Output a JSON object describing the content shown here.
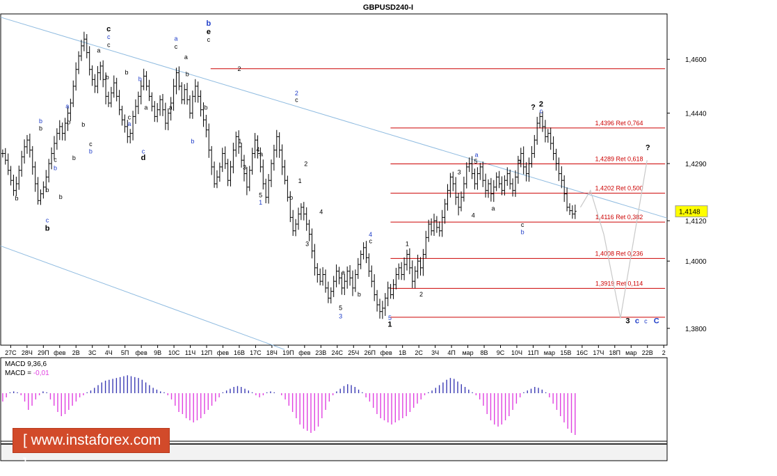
{
  "colors": {
    "background": "#ffffff",
    "frame": "#000000",
    "price": "#000000",
    "channel": "#8fbbe0",
    "retracement": "#cc0000",
    "current_price_bg": "#ffff00",
    "projection": "#c8c8c8",
    "macd_positive": "#3a3ab4",
    "macd_negative": "#e040e0",
    "macd_signal": "#e040e0",
    "watermark_bg": "#d24a2a",
    "label_black": "#000000",
    "label_blue": "#1e3cc8"
  },
  "chart_data": {
    "type": "candlestick",
    "title": "GBPUSD240-I",
    "symbol": "GBPUSD",
    "timeframe": "H4",
    "ylim": [
      1.375,
      1.4735
    ],
    "y_ticks": [
      "1,4600",
      "1,4440",
      "1,4290",
      "1,4120",
      "1,4000",
      "1,3800"
    ],
    "current_price": "1,4148",
    "x_tick_labels": [
      "27С",
      "28Ч",
      "29П",
      "фев",
      "2В",
      "3С",
      "4Ч",
      "5П",
      "фев",
      "9В",
      "10С",
      "11Ч",
      "12П",
      "фев",
      "16В",
      "17С",
      "18Ч",
      "19П",
      "фев",
      "23В",
      "24С",
      "25Ч",
      "26П",
      "фев",
      "1В",
      "2С",
      "3Ч",
      "4П",
      "мар",
      "8В",
      "9С",
      "10Ч",
      "11П",
      "мар",
      "15В",
      "16С",
      "17Ч",
      "18П",
      "мар",
      "22В",
      "2"
    ],
    "close_path": [
      1.432,
      1.43,
      1.427,
      1.424,
      1.421,
      1.423,
      1.427,
      1.431,
      1.434,
      1.436,
      1.433,
      1.428,
      1.423,
      1.418,
      1.42,
      1.422,
      1.425,
      1.429,
      1.432,
      1.435,
      1.438,
      1.44,
      1.438,
      1.441,
      1.444,
      1.447,
      1.452,
      1.457,
      1.461,
      1.464,
      1.466,
      1.462,
      1.457,
      1.454,
      1.452,
      1.456,
      1.458,
      1.454,
      1.449,
      1.447,
      1.45,
      1.453,
      1.449,
      1.445,
      1.442,
      1.44,
      1.437,
      1.438,
      1.443,
      1.446,
      1.449,
      1.452,
      1.455,
      1.452,
      1.449,
      1.446,
      1.443,
      1.445,
      1.448,
      1.445,
      1.441,
      1.444,
      1.447,
      1.452,
      1.456,
      1.452,
      1.448,
      1.451,
      1.448,
      1.444,
      1.449,
      1.452,
      1.449,
      1.445,
      1.442,
      1.439,
      1.433,
      1.428,
      1.423,
      1.425,
      1.428,
      1.432,
      1.429,
      1.424,
      1.428,
      1.433,
      1.437,
      1.434,
      1.43,
      1.426,
      1.422,
      1.427,
      1.432,
      1.436,
      1.432,
      1.428,
      1.423,
      1.419,
      1.424,
      1.429,
      1.433,
      1.437,
      1.433,
      1.428,
      1.424,
      1.419,
      1.413,
      1.409,
      1.411,
      1.414,
      1.416,
      1.414,
      1.411,
      1.408,
      1.403,
      1.398,
      1.396,
      1.394,
      1.396,
      1.392,
      1.389,
      1.391,
      1.394,
      1.397,
      1.395,
      1.392,
      1.394,
      1.397,
      1.395,
      1.392,
      1.396,
      1.399,
      1.402,
      1.404,
      1.401,
      1.397,
      1.394,
      1.39,
      1.387,
      1.385,
      1.386,
      1.389,
      1.392,
      1.39,
      1.393,
      1.396,
      1.398,
      1.396,
      1.399,
      1.402,
      1.398,
      1.394,
      1.397,
      1.4,
      1.398,
      1.402,
      1.407,
      1.411,
      1.409,
      1.412,
      1.41,
      1.409,
      1.413,
      1.417,
      1.421,
      1.425,
      1.423,
      1.419,
      1.416,
      1.419,
      1.423,
      1.428,
      1.429,
      1.426,
      1.423,
      1.426,
      1.428,
      1.424,
      1.421,
      1.423,
      1.42,
      1.422,
      1.425,
      1.423,
      1.421,
      1.424,
      1.426,
      1.423,
      1.421,
      1.425,
      1.43,
      1.432,
      1.428,
      1.426,
      1.429,
      1.432,
      1.436,
      1.441,
      1.443,
      1.44,
      1.437,
      1.438,
      1.435,
      1.432,
      1.429,
      1.426,
      1.424,
      1.42,
      1.416,
      1.415,
      1.414,
      1.4148
    ],
    "channel_lines": [
      {
        "x": [
          0,
          1
        ],
        "y": [
          1.4725,
          1.4128
        ]
      },
      {
        "x": [
          0,
          0.426
        ],
        "y": [
          1.4045,
          1.3737
        ]
      }
    ],
    "fibonacci": [
      {
        "price": 1.4572,
        "label": ""
      },
      {
        "price": 1.4396,
        "label": "1,4396 Ret 0,764"
      },
      {
        "price": 1.4289,
        "label": "1,4289 Ret 0,618"
      },
      {
        "price": 1.4202,
        "label": "1,4202 Ret 0,500"
      },
      {
        "price": 1.4116,
        "label": "1,4116 Ret 0,382"
      },
      {
        "price": 1.4008,
        "label": "1,4008 Ret 0,236"
      },
      {
        "price": 1.3919,
        "label": "1,3919 Ret 0,114"
      },
      {
        "price": 1.3833,
        "label": ""
      }
    ],
    "projection": {
      "x": [
        0.87,
        0.885,
        0.905,
        0.93,
        0.97
      ],
      "y": [
        1.416,
        1.421,
        1.408,
        1.383,
        1.43
      ]
    },
    "wave_labels": [
      {
        "text": "c",
        "x": 0.162,
        "y": 1.4683,
        "color": "black",
        "bold": true
      },
      {
        "text": "c",
        "x": 0.162,
        "y": 1.466,
        "color": "blue"
      },
      {
        "text": "c",
        "x": 0.162,
        "y": 1.4637,
        "color": "black"
      },
      {
        "text": "a",
        "x": 0.147,
        "y": 1.462,
        "color": "black"
      },
      {
        "text": "b",
        "x": 0.06,
        "y": 1.441,
        "color": "blue"
      },
      {
        "text": "b",
        "x": 0.06,
        "y": 1.4388,
        "color": "black"
      },
      {
        "text": "b",
        "x": 0.024,
        "y": 1.418,
        "color": "black"
      },
      {
        "text": "a",
        "x": 0.1,
        "y": 1.4455,
        "color": "blue"
      },
      {
        "text": "b",
        "x": 0.102,
        "y": 1.4407,
        "color": "black"
      },
      {
        "text": "c",
        "x": 0.082,
        "y": 1.4295,
        "color": "black"
      },
      {
        "text": "b",
        "x": 0.082,
        "y": 1.427,
        "color": "blue"
      },
      {
        "text": "b",
        "x": 0.07,
        "y": 1.4205,
        "color": "black"
      },
      {
        "text": "b",
        "x": 0.09,
        "y": 1.4185,
        "color": "black"
      },
      {
        "text": "b",
        "x": 0.11,
        "y": 1.43,
        "color": "black"
      },
      {
        "text": "c",
        "x": 0.07,
        "y": 1.4115,
        "color": "blue"
      },
      {
        "text": "b",
        "x": 0.07,
        "y": 1.409,
        "color": "black",
        "bold": true
      },
      {
        "text": "b",
        "x": 0.124,
        "y": 1.44,
        "color": "black"
      },
      {
        "text": "c",
        "x": 0.135,
        "y": 1.4342,
        "color": "black"
      },
      {
        "text": "b",
        "x": 0.135,
        "y": 1.432,
        "color": "blue"
      },
      {
        "text": "b",
        "x": 0.16,
        "y": 1.454,
        "color": "black"
      },
      {
        "text": "b",
        "x": 0.189,
        "y": 1.4555,
        "color": "black"
      },
      {
        "text": "b",
        "x": 0.209,
        "y": 1.4535,
        "color": "blue"
      },
      {
        "text": "c",
        "x": 0.193,
        "y": 1.4422,
        "color": "black"
      },
      {
        "text": "a",
        "x": 0.193,
        "y": 1.4402,
        "color": "blue"
      },
      {
        "text": "a",
        "x": 0.218,
        "y": 1.445,
        "color": "black"
      },
      {
        "text": "c",
        "x": 0.214,
        "y": 1.432,
        "color": "blue"
      },
      {
        "text": "d",
        "x": 0.214,
        "y": 1.43,
        "color": "black",
        "bold": true
      },
      {
        "text": "a",
        "x": 0.263,
        "y": 1.4655,
        "color": "blue"
      },
      {
        "text": "c",
        "x": 0.263,
        "y": 1.4632,
        "color": "black"
      },
      {
        "text": "b",
        "x": 0.312,
        "y": 1.47,
        "color": "blue",
        "bold": true
      },
      {
        "text": "e",
        "x": 0.312,
        "y": 1.4675,
        "color": "black",
        "bold": true
      },
      {
        "text": "c",
        "x": 0.312,
        "y": 1.4652,
        "color": "black"
      },
      {
        "text": "a",
        "x": 0.278,
        "y": 1.46,
        "color": "black"
      },
      {
        "text": "b",
        "x": 0.28,
        "y": 1.455,
        "color": "black"
      },
      {
        "text": "a",
        "x": 0.255,
        "y": 1.445,
        "color": "black"
      },
      {
        "text": "b",
        "x": 0.288,
        "y": 1.435,
        "color": "blue"
      },
      {
        "text": "b",
        "x": 0.308,
        "y": 1.445,
        "color": "black"
      },
      {
        "text": "2",
        "x": 0.358,
        "y": 1.4565,
        "color": "black"
      },
      {
        "text": "1",
        "x": 0.359,
        "y": 1.435,
        "color": "black"
      },
      {
        "text": "3",
        "x": 0.366,
        "y": 1.4272,
        "color": "black"
      },
      {
        "text": "4",
        "x": 0.386,
        "y": 1.4325,
        "color": "black"
      },
      {
        "text": "a",
        "x": 0.391,
        "y": 1.4312,
        "color": "black"
      },
      {
        "text": "5",
        "x": 0.39,
        "y": 1.419,
        "color": "black"
      },
      {
        "text": "1",
        "x": 0.39,
        "y": 1.4168,
        "color": "blue"
      },
      {
        "text": "2",
        "x": 0.444,
        "y": 1.4493,
        "color": "blue"
      },
      {
        "text": "c",
        "x": 0.444,
        "y": 1.4473,
        "color": "black"
      },
      {
        "text": "b",
        "x": 0.436,
        "y": 1.4183,
        "color": "black"
      },
      {
        "text": "1",
        "x": 0.449,
        "y": 1.4232,
        "color": "black"
      },
      {
        "text": "2",
        "x": 0.458,
        "y": 1.4283,
        "color": "black"
      },
      {
        "text": "4",
        "x": 0.481,
        "y": 1.414,
        "color": "black"
      },
      {
        "text": "3",
        "x": 0.46,
        "y": 1.4045,
        "color": "black"
      },
      {
        "text": "a",
        "x": 0.514,
        "y": 1.396,
        "color": "black"
      },
      {
        "text": "b",
        "x": 0.538,
        "y": 1.3895,
        "color": "black"
      },
      {
        "text": "5",
        "x": 0.51,
        "y": 1.3855,
        "color": "black"
      },
      {
        "text": "3",
        "x": 0.51,
        "y": 1.383,
        "color": "blue"
      },
      {
        "text": "4",
        "x": 0.555,
        "y": 1.4073,
        "color": "blue"
      },
      {
        "text": "c",
        "x": 0.555,
        "y": 1.4053,
        "color": "black"
      },
      {
        "text": "5",
        "x": 0.584,
        "y": 1.3825,
        "color": "blue"
      },
      {
        "text": "1",
        "x": 0.584,
        "y": 1.3805,
        "color": "black",
        "bold": true
      },
      {
        "text": "1",
        "x": 0.61,
        "y": 1.4045,
        "color": "black"
      },
      {
        "text": "2",
        "x": 0.631,
        "y": 1.3895,
        "color": "black"
      },
      {
        "text": "3",
        "x": 0.688,
        "y": 1.4258,
        "color": "black"
      },
      {
        "text": "4",
        "x": 0.709,
        "y": 1.413,
        "color": "black"
      },
      {
        "text": "a",
        "x": 0.714,
        "y": 1.431,
        "color": "blue"
      },
      {
        "text": "5",
        "x": 0.713,
        "y": 1.429,
        "color": "black"
      },
      {
        "text": "a",
        "x": 0.739,
        "y": 1.415,
        "color": "black"
      },
      {
        "text": "c",
        "x": 0.783,
        "y": 1.4102,
        "color": "black"
      },
      {
        "text": "b",
        "x": 0.783,
        "y": 1.408,
        "color": "blue"
      },
      {
        "text": "b",
        "x": 0.778,
        "y": 1.429,
        "color": "black"
      },
      {
        "text": "?",
        "x": 0.799,
        "y": 1.445,
        "color": "black",
        "bold": true
      },
      {
        "text": "2",
        "x": 0.811,
        "y": 1.446,
        "color": "black",
        "bold": true
      },
      {
        "text": "c",
        "x": 0.811,
        "y": 1.444,
        "color": "blue"
      },
      {
        "text": "?",
        "x": 0.971,
        "y": 1.433,
        "color": "black",
        "bold": true
      },
      {
        "text": "3",
        "x": 0.941,
        "y": 1.3815,
        "color": "black",
        "bold": true
      },
      {
        "text": "c",
        "x": 0.955,
        "y": 1.3815,
        "color": "blue",
        "bold": true
      },
      {
        "text": "c",
        "x": 0.968,
        "y": 1.3815,
        "color": "blue"
      },
      {
        "text": "C",
        "x": 0.984,
        "y": 1.3815,
        "color": "blue",
        "bold": true
      }
    ],
    "indicator": {
      "name": "MACD",
      "label1": "MACD 9,36,6",
      "label2_prefix": "MACD = ",
      "label2_value": "-0,01",
      "hist": [
        -0.2,
        -0.1,
        0.05,
        0.1,
        0.05,
        -0.05,
        -0.2,
        -0.4,
        -0.3,
        -0.15,
        -0.05,
        0.1,
        0.05,
        -0.15,
        -0.3,
        -0.45,
        -0.55,
        -0.5,
        -0.4,
        -0.3,
        -0.2,
        -0.1,
        -0.05,
        0.05,
        0.15,
        0.3,
        0.45,
        0.6,
        0.7,
        0.75,
        0.8,
        0.85,
        0.9,
        0.95,
        1.0,
        0.95,
        0.9,
        0.85,
        0.75,
        0.6,
        0.45,
        0.3,
        0.2,
        0.1,
        0.05,
        -0.05,
        -0.15,
        -0.3,
        -0.45,
        -0.5,
        -0.6,
        -0.65,
        -0.7,
        -0.65,
        -0.6,
        -0.5,
        -0.4,
        -0.3,
        -0.2,
        -0.1,
        0.05,
        0.15,
        0.25,
        0.35,
        0.4,
        0.35,
        0.25,
        0.15,
        0.05,
        -0.05,
        -0.1,
        -0.05,
        0.05,
        0.1,
        0.05,
        0.0,
        -0.05,
        -0.15,
        -0.3,
        -0.45,
        -0.6,
        -0.75,
        -0.85,
        -0.9,
        -0.95,
        -0.9,
        -0.8,
        -0.6,
        -0.4,
        -0.2,
        -0.05,
        0.1,
        0.25,
        0.4,
        0.5,
        0.45,
        0.35,
        0.2,
        0.05,
        -0.1,
        -0.2,
        -0.35,
        -0.5,
        -0.6,
        -0.65,
        -0.7,
        -0.75,
        -0.7,
        -0.65,
        -0.6,
        -0.55,
        -0.45,
        -0.35,
        -0.25,
        -0.15,
        -0.05,
        0.05,
        0.15,
        0.3,
        0.45,
        0.6,
        0.75,
        0.85,
        0.8,
        0.65,
        0.5,
        0.35,
        0.2,
        0.05,
        -0.05,
        -0.15,
        -0.3,
        -0.5,
        -0.65,
        -0.75,
        -0.8,
        -0.75,
        -0.65,
        -0.55,
        -0.4,
        -0.25,
        -0.1,
        0.05,
        0.15,
        0.25,
        0.35,
        0.3,
        0.2,
        0.05,
        -0.1,
        -0.25,
        -0.4,
        -0.55,
        -0.7,
        -0.85,
        -0.95,
        -1.0
      ],
      "hist_range": [
        -1.05,
        1.05
      ]
    }
  },
  "watermark": {
    "text": "[ www.instaforex.com ]"
  }
}
